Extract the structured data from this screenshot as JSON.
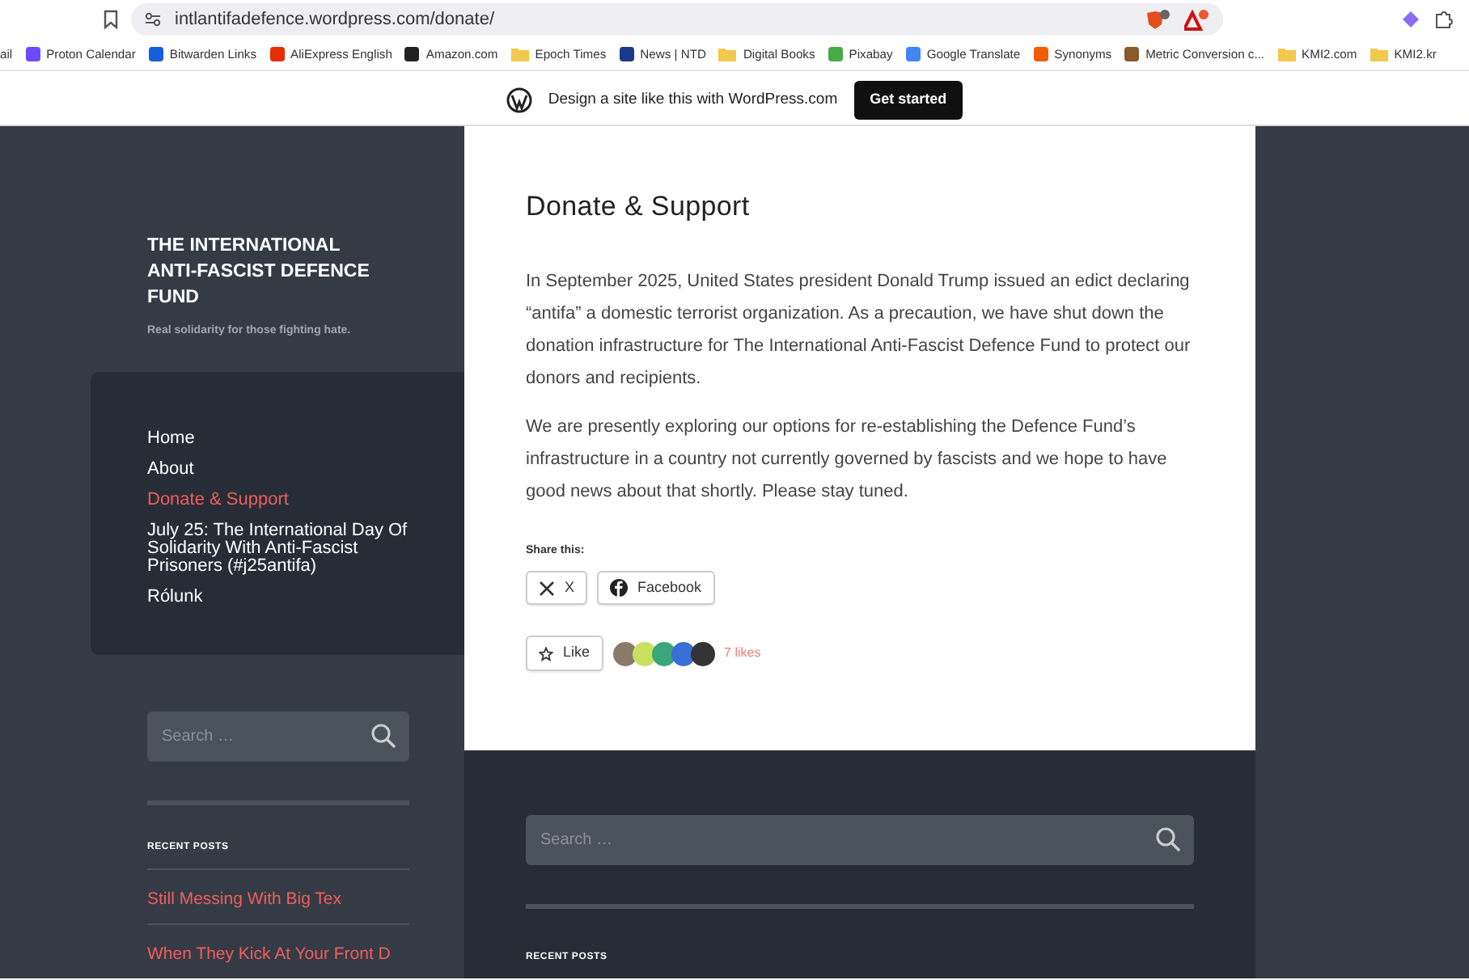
{
  "browser": {
    "url": "intlantifadefence.wordpress.com/donate/",
    "bookmarks": [
      {
        "label": "ail",
        "kind": "none"
      },
      {
        "label": "Proton Calendar",
        "kind": "site",
        "color": "#6d4aff"
      },
      {
        "label": "Bitwarden Links",
        "kind": "site",
        "color": "#175ddc"
      },
      {
        "label": "AliExpress English",
        "kind": "site",
        "color": "#e62e04"
      },
      {
        "label": "Amazon.com",
        "kind": "site",
        "color": "#222222"
      },
      {
        "label": "Epoch Times",
        "kind": "folder",
        "color": "#f2c94c"
      },
      {
        "label": "News | NTD",
        "kind": "site",
        "color": "#1a3a8a"
      },
      {
        "label": "Digital Books",
        "kind": "folder",
        "color": "#f2c94c"
      },
      {
        "label": "Pixabay",
        "kind": "site",
        "color": "#48a947"
      },
      {
        "label": "Google Translate",
        "kind": "site",
        "color": "#4285f4"
      },
      {
        "label": "Synonyms",
        "kind": "site",
        "color": "#f25c05"
      },
      {
        "label": "Metric Conversion c...",
        "kind": "site",
        "color": "#8a5a2b"
      },
      {
        "label": "KMI2.com",
        "kind": "folder",
        "color": "#f2c94c"
      },
      {
        "label": "KMI2.kr",
        "kind": "folder",
        "color": "#f2c94c"
      }
    ]
  },
  "wp_banner": {
    "text": "Design a site like this with WordPress.com",
    "button": "Get started"
  },
  "site": {
    "title": "THE INTERNATIONAL ANTI-FASCIST DEFENCE FUND",
    "tagline": "Real solidarity for those fighting hate."
  },
  "nav": [
    {
      "label": "Home",
      "selected": false
    },
    {
      "label": "About",
      "selected": false
    },
    {
      "label": "Donate & Support",
      "selected": true
    },
    {
      "label": "July 25: The International Day Of Solidarity With Anti-Fascist Prisoners (#j25antifa)",
      "selected": false
    },
    {
      "label": "Rólunk",
      "selected": false
    }
  ],
  "sidebar": {
    "search_placeholder": "Search …",
    "recent_posts_title": "RECENT POSTS",
    "recent_posts": [
      "Still Messing With Big Tex",
      "When They Kick At Your Front D"
    ]
  },
  "post": {
    "title": "Donate & Support",
    "paragraphs": [
      "In September 2025, United States president Donald Trump issued an edict declaring “antifa” a domestic terrorist organization. As a precaution, we have shut down the donation infrastructure for The International Anti-Fascist Defence Fund to protect our donors and recipients.",
      "We are presently exploring our options for re-establishing the Defence Fund’s infrastructure in a country not currently governed by fascists and we hope to have good news about that shortly. Please stay tuned."
    ],
    "share_label": "Share this:",
    "share_buttons": [
      {
        "kind": "x",
        "label": "X"
      },
      {
        "kind": "facebook",
        "label": "Facebook"
      }
    ],
    "like_button": "Like",
    "likes": "7 likes"
  },
  "footer": {
    "search_placeholder": "Search …",
    "recent_posts_title": "RECENT POSTS"
  }
}
